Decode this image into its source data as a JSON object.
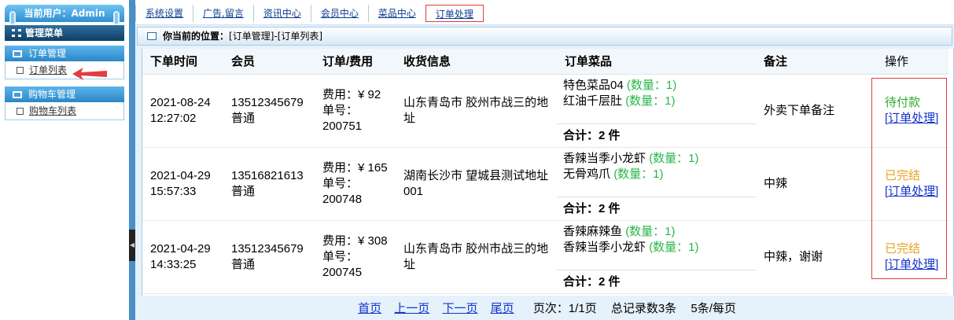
{
  "sidebar": {
    "user_label": "当前用户：Admin",
    "menu_title": "管理菜单",
    "groups": [
      {
        "title": "订单管理",
        "items": [
          {
            "label": "订单列表"
          }
        ]
      },
      {
        "title": "购物车管理",
        "items": [
          {
            "label": "购物车列表"
          }
        ]
      }
    ]
  },
  "topnav": {
    "tabs": [
      {
        "label": "系统设置"
      },
      {
        "label": "广告,留言"
      },
      {
        "label": "资讯中心"
      },
      {
        "label": "会员中心"
      },
      {
        "label": "菜品中心"
      },
      {
        "label": "订单处理",
        "active": true
      }
    ]
  },
  "breadcrumb": {
    "prefix": "你当前的位置：",
    "path": "[订单管理]-[订单列表]"
  },
  "table": {
    "headers": {
      "time": "下单时间",
      "member": "会员",
      "order": "订单/费用",
      "address": "收货信息",
      "items": "订单菜品",
      "remark": "备注",
      "action": "操作"
    },
    "rows": [
      {
        "date": "2021-08-24",
        "time": "12:27:02",
        "phone": "13512345679",
        "level": "普通",
        "fee": "费用：¥ 92",
        "order_label": "单号：",
        "order_no": "200751",
        "address": "山东青岛市 胶州市战三的地址",
        "items": [
          {
            "name": "特色菜品04",
            "qty": "(数量：1)"
          },
          {
            "name": "红油千层肚",
            "qty": "(数量：1)"
          }
        ],
        "total": "合计：2 件",
        "remark": "外卖下单备注",
        "status": "待付款",
        "status_type": "pending",
        "action": "[订单处理]"
      },
      {
        "date": "2021-04-29",
        "time": "15:57:33",
        "phone": "13516821613",
        "level": "普通",
        "fee": "费用：¥ 165",
        "order_label": "单号：",
        "order_no": "200748",
        "address": "湖南长沙市 望城县测试地址001",
        "items": [
          {
            "name": "香辣当季小龙虾",
            "qty": "(数量：1)"
          },
          {
            "name": "无骨鸡爪",
            "qty": "(数量：1)"
          }
        ],
        "total": "合计：2 件",
        "remark": "中辣",
        "status": "已完结",
        "status_type": "done",
        "action": "[订单处理]"
      },
      {
        "date": "2021-04-29",
        "time": "14:33:25",
        "phone": "13512345679",
        "level": "普通",
        "fee": "费用：¥ 308",
        "order_label": "单号：",
        "order_no": "200745",
        "address": "山东青岛市 胶州市战三的地址",
        "items": [
          {
            "name": "香辣麻辣鱼",
            "qty": "(数量：1)"
          },
          {
            "name": "香辣当季小龙虾",
            "qty": "(数量：1)"
          }
        ],
        "total": "合计：2 件",
        "remark": "中辣，谢谢",
        "status": "已完结",
        "status_type": "done",
        "action": "[订单处理]"
      }
    ]
  },
  "pager": {
    "first": "首页",
    "prev": "上一页",
    "next": "下一页",
    "last": "尾页",
    "page_info": "页次：1/1页",
    "total_info": "总记录数3条",
    "per_page": "5条/每页"
  },
  "colors": {
    "accent": "#2a87c8",
    "highlight_border": "#e23c3c",
    "qty_green": "#27b64a",
    "pending_green": "#2fa82f",
    "done_orange": "#e6a321",
    "link_blue": "#1133cc"
  }
}
